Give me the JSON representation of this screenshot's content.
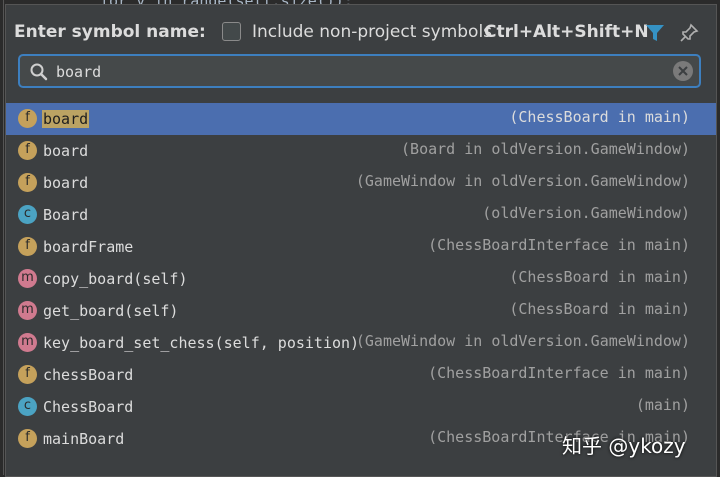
{
  "background": {
    "code_snippet": "for y in range(self.size()):"
  },
  "dialog": {
    "title": "Enter symbol name:",
    "include_label": "Include non-project symbols",
    "shortcut": "Ctrl+Alt+Shift+N",
    "include_checked": false
  },
  "search": {
    "value": "board",
    "placeholder": ""
  },
  "results": [
    {
      "kind": "f",
      "name": "board",
      "location": "(ChessBoard in main)",
      "selected": true
    },
    {
      "kind": "f",
      "name": "board",
      "location": "(Board in oldVersion.GameWindow)"
    },
    {
      "kind": "f",
      "name": "board",
      "location": "(GameWindow in oldVersion.GameWindow)"
    },
    {
      "kind": "c",
      "name": "Board",
      "location": "(oldVersion.GameWindow)"
    },
    {
      "kind": "f",
      "name": "boardFrame",
      "location": "(ChessBoardInterface in main)"
    },
    {
      "kind": "m",
      "name": "copy_board(self)",
      "location": "(ChessBoard in main)"
    },
    {
      "kind": "m",
      "name": "get_board(self)",
      "location": "(ChessBoard in main)"
    },
    {
      "kind": "m",
      "name": "key_board_set_chess(self, position)",
      "location": "(GameWindow in oldVersion.GameWindow)"
    },
    {
      "kind": "f",
      "name": "chessBoard",
      "location": "(ChessBoardInterface in main)"
    },
    {
      "kind": "c",
      "name": "ChessBoard",
      "location": "(main)"
    },
    {
      "kind": "f",
      "name": "mainBoard",
      "location": "(ChessBoardInterface in main)"
    }
  ],
  "watermark": "知乎 @ykozy",
  "colors": {
    "selection": "#4b6eaf",
    "field_badge": "#c5a15b",
    "method_badge": "#d07a8f",
    "class_badge": "#4ba3c3",
    "accent": "#3d7fbf"
  }
}
